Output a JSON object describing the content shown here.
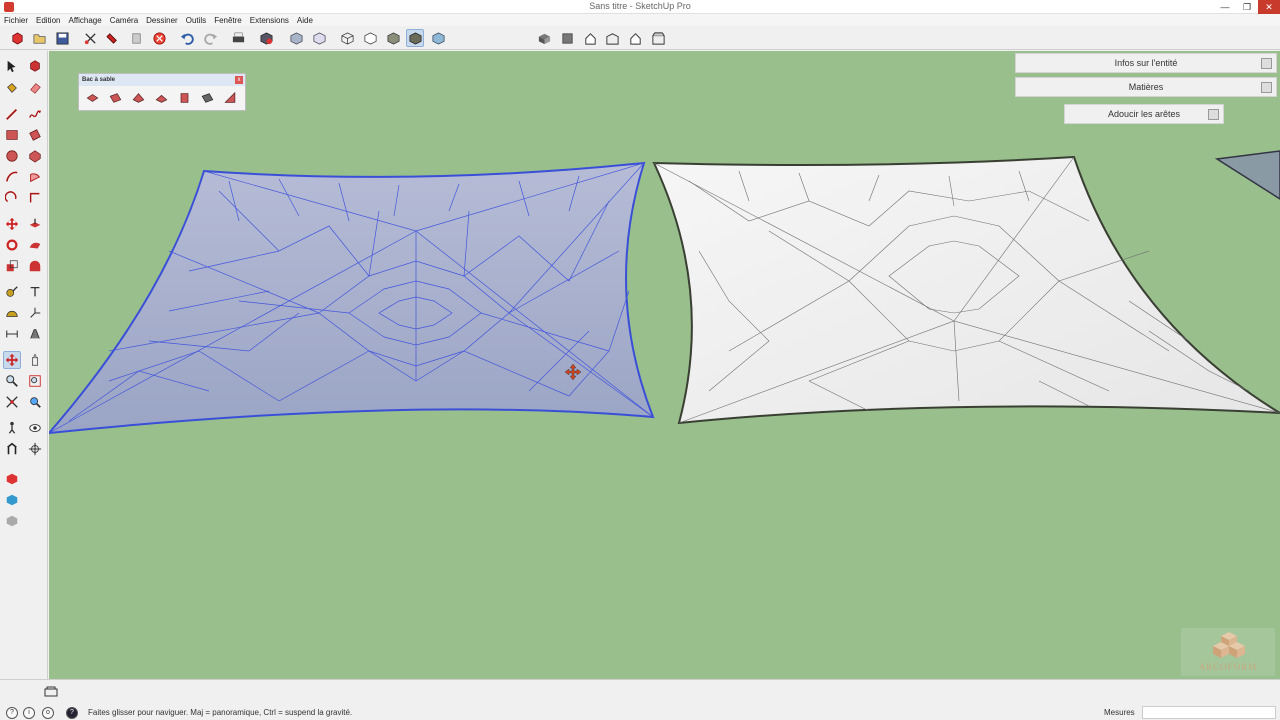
{
  "window": {
    "title": "Sans titre - SketchUp Pro",
    "minimize": "—",
    "maximize": "❐",
    "close": "✕"
  },
  "menu": [
    "Fichier",
    "Edition",
    "Affichage",
    "Caméra",
    "Dessiner",
    "Outils",
    "Fenêtre",
    "Extensions",
    "Aide"
  ],
  "floating_toolbar": {
    "title": "Bac à sable",
    "close": "x"
  },
  "trays": {
    "entity_info": "Infos sur l'entité",
    "materials": "Matières",
    "soften_edges": "Adoucir les arêtes"
  },
  "status": {
    "hint": "Faites glisser pour naviguer. Maj = panoramique, Ctrl = suspend la gravité.",
    "measure_label": "Mesures",
    "measure_value": ""
  },
  "logo": {
    "text": "ARCOFORM"
  },
  "colors": {
    "viewport": "#98bf8c",
    "selection": "#3a4fd8",
    "mesh_selected": "#a9b3d3",
    "mesh_white": "#f5f5f5"
  },
  "toolbar_icons": [
    "components-icon",
    "open-icon",
    "save-icon",
    "cut-icon",
    "paint-icon",
    "copy-icon",
    "erase-icon",
    "undo-icon",
    "redo-icon",
    "print-icon",
    "model-info-icon",
    "xray-icon",
    "wireframe-icon",
    "hidden-line-icon",
    "shaded-icon",
    "shaded-textures-icon",
    "monochrome-icon",
    "iso-view-icon",
    "top-view-icon",
    "front-view-icon",
    "right-view-icon",
    "back-view-icon",
    "left-view-icon"
  ],
  "left_tools": [
    "select-icon",
    "make-component-icon",
    "paint-bucket-icon",
    "eraser-icon",
    "line-icon",
    "freehand-icon",
    "rectangle-icon",
    "rotated-rectangle-icon",
    "circle-icon",
    "polygon-icon",
    "arc-icon",
    "pie-icon",
    "three-point-arc-icon",
    "two-point-arc-icon",
    "move-icon",
    "push-pull-icon",
    "rotate-icon",
    "follow-me-icon",
    "scale-icon",
    "offset-icon",
    "tape-measure-icon",
    "text-icon",
    "protractor-icon",
    "axes-icon",
    "dimension-icon",
    "3d-text-icon",
    "orbit-icon",
    "pan-icon",
    "zoom-icon",
    "zoom-window-icon",
    "zoom-extents-icon",
    "previous-view-icon",
    "walk-icon",
    "look-around-icon",
    "position-camera-icon",
    "section-plane-icon",
    "warehouse-icon",
    "extension-warehouse-icon",
    "layout-icon"
  ]
}
